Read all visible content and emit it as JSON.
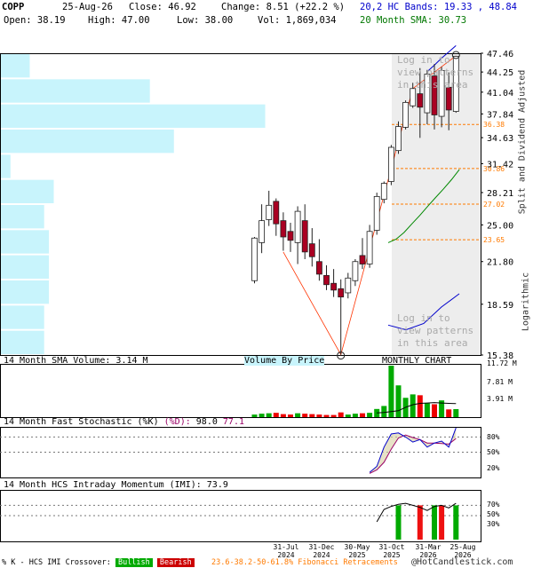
{
  "header": {
    "symbol": "COPP",
    "date": "25-Aug-26",
    "close_label": "Close: 46.92",
    "change_label": "Change: 8.51 (+22.2 %)",
    "open_label": "Open: 38.19",
    "high_label": "High: 47.00",
    "low_label": "Low: 38.00",
    "vol_label": "Vol: 1,869,034",
    "hc_bands_label": "20,2 HC Bands: 19.33 , 48.84",
    "sma_label": "20 Month SMA: 30.73"
  },
  "watermark": "Log in to view patterns in this area",
  "side_labels": {
    "split": "Split and Dividend Adjusted",
    "log": "Logarithmic"
  },
  "panel_titles": {
    "volume_sma": "14 Month SMA Volume: 3.14 M",
    "volume_by_price": "Volume By Price",
    "monthly": "MONTHLY CHART",
    "stoch_prefix": "14 Month Fast Stochastic (%K)",
    "stoch_d": "(%D):",
    "stoch_k_val": "98.0",
    "stoch_d_val": "77.1",
    "imi": "14 Month HCS Intraday Momentum (IMI): 73.9"
  },
  "footer": {
    "crossover": "% K - HCS IMI Crossover:",
    "bullish": "Bullish",
    "bearish": "Bearish",
    "fib": "23.6-38.2-50-61.8% Fibonacci Retracements",
    "copyright": "@HotCandlestick.com"
  },
  "colors": {
    "bull": "#00aa00",
    "bear": "#aa0022",
    "vbp": "#c8f4fc",
    "band": "#0000cc",
    "sma": "#008800",
    "fib": "#ff7a00",
    "trend": "#ff3300",
    "shade": "#ededed"
  },
  "chart_data": [
    {
      "type": "candlestick",
      "title": "MONTHLY CHART",
      "x_tick_labels": [
        "31-Jul 2024",
        "31-Dec 2024",
        "30-May 2025",
        "31-Oct 2025",
        "31-Mar 2026",
        "25-Aug 2026"
      ],
      "y_ticks": [
        47.46,
        44.25,
        41.04,
        37.84,
        34.63,
        31.42,
        28.21,
        25.0,
        21.8,
        18.59,
        15.38
      ],
      "y_scale": "log",
      "ylim": [
        15.38,
        47.46
      ],
      "fib_levels": [
        36.38,
        30.86,
        27.02,
        23.65
      ],
      "candles": [
        {
          "o": 20.3,
          "h": 23.9,
          "l": 20.1,
          "c": 23.8
        },
        {
          "o": 23.4,
          "h": 27.0,
          "l": 22.5,
          "c": 25.4
        },
        {
          "o": 25.5,
          "h": 28.4,
          "l": 24.9,
          "c": 26.9
        },
        {
          "o": 27.3,
          "h": 27.6,
          "l": 24.0,
          "c": 25.1
        },
        {
          "o": 25.4,
          "h": 26.2,
          "l": 22.7,
          "c": 23.9
        },
        {
          "o": 24.4,
          "h": 25.2,
          "l": 22.6,
          "c": 23.6
        },
        {
          "o": 23.4,
          "h": 26.8,
          "l": 21.6,
          "c": 26.3
        },
        {
          "o": 25.4,
          "h": 27.0,
          "l": 22.0,
          "c": 22.6
        },
        {
          "o": 23.3,
          "h": 24.7,
          "l": 21.4,
          "c": 22.2
        },
        {
          "o": 21.8,
          "h": 23.7,
          "l": 20.3,
          "c": 20.8
        },
        {
          "o": 20.7,
          "h": 21.5,
          "l": 19.6,
          "c": 20.0
        },
        {
          "o": 20.1,
          "h": 21.2,
          "l": 19.1,
          "c": 19.6
        },
        {
          "o": 19.7,
          "h": 20.4,
          "l": 15.4,
          "c": 19.1
        },
        {
          "o": 19.4,
          "h": 20.9,
          "l": 19.0,
          "c": 20.5
        },
        {
          "o": 20.3,
          "h": 22.0,
          "l": 19.9,
          "c": 21.8
        },
        {
          "o": 22.3,
          "h": 23.8,
          "l": 21.2,
          "c": 21.6
        },
        {
          "o": 21.6,
          "h": 25.0,
          "l": 21.3,
          "c": 24.4
        },
        {
          "o": 24.5,
          "h": 28.2,
          "l": 24.1,
          "c": 27.8
        },
        {
          "o": 27.5,
          "h": 29.4,
          "l": 27.1,
          "c": 29.2
        },
        {
          "o": 29.4,
          "h": 33.7,
          "l": 29.0,
          "c": 33.4
        },
        {
          "o": 33.0,
          "h": 36.8,
          "l": 32.6,
          "c": 36.1
        },
        {
          "o": 36.0,
          "h": 39.8,
          "l": 35.7,
          "c": 39.5
        },
        {
          "o": 39.0,
          "h": 42.5,
          "l": 38.7,
          "c": 41.6
        },
        {
          "o": 40.8,
          "h": 44.9,
          "l": 34.6,
          "c": 38.8
        },
        {
          "o": 38.0,
          "h": 44.6,
          "l": 36.4,
          "c": 43.9
        },
        {
          "o": 43.6,
          "h": 45.6,
          "l": 35.7,
          "c": 37.7
        },
        {
          "o": 37.5,
          "h": 45.1,
          "l": 36.0,
          "c": 44.5
        },
        {
          "o": 41.8,
          "h": 44.2,
          "l": 35.6,
          "c": 38.4
        },
        {
          "o": 38.19,
          "h": 47.0,
          "l": 38.0,
          "c": 46.92
        }
      ],
      "upper_band": [
        44.3,
        45.4,
        46.6,
        47.7,
        48.84
      ],
      "lower_band": [
        17.2,
        16.9,
        17.3,
        18.4,
        19.33
      ],
      "sma": [
        23.4,
        23.7,
        24.3,
        25.1,
        25.9,
        26.8,
        27.7,
        28.6,
        29.6,
        30.73
      ],
      "vbp_widths": [
        0.06,
        0.31,
        0.55,
        0.36,
        0.02,
        0.11,
        0.09,
        0.1,
        0.1,
        0.1,
        0.09,
        0.09
      ],
      "annotations": [
        "Log in to view patterns in this area"
      ]
    },
    {
      "type": "bar",
      "title": "14 Month SMA Volume: 3.14 M",
      "y_ticks": [
        "11.72 M",
        "7.81 M",
        "3.91 M"
      ],
      "ylim": [
        0,
        12.0
      ],
      "values": [
        0.6,
        0.8,
        0.9,
        1.0,
        0.7,
        0.6,
        0.9,
        0.8,
        0.7,
        0.6,
        0.5,
        0.5,
        1.1,
        0.6,
        0.8,
        0.9,
        1.0,
        1.9,
        2.6,
        12.0,
        7.4,
        4.5,
        5.3,
        5.1,
        3.2,
        3.0,
        3.9,
        1.8,
        1.87
      ],
      "sma_line": [
        1.0,
        1.1,
        1.3,
        1.5,
        2.3,
        2.9,
        3.2,
        3.3,
        3.4,
        3.3,
        3.2,
        3.14
      ]
    },
    {
      "type": "line",
      "title": "14 Month Fast Stochastic (%K) (%D): 98.0 77.1",
      "y_ticks": [
        "80%",
        "50%",
        "20%"
      ],
      "ylim": [
        0,
        100
      ],
      "k": [
        10,
        22,
        60,
        86,
        88,
        80,
        70,
        75,
        60,
        68,
        72,
        60,
        98.0
      ],
      "d": [
        8,
        15,
        30,
        56,
        78,
        84,
        79,
        75,
        68,
        68,
        67,
        66,
        77.1
      ]
    },
    {
      "type": "bar",
      "title": "14 Month HCS Intraday Momentum (IMI): 73.9",
      "y_ticks": [
        "70%",
        "50%",
        "30%"
      ],
      "ylim": [
        0,
        100
      ],
      "imi_line": [
        38,
        62,
        68,
        72,
        74,
        70,
        66,
        60,
        68,
        70,
        65,
        73.9
      ],
      "crossover_signals": [
        {
          "month_index": 20,
          "signal": "bullish"
        },
        {
          "month_index": 23,
          "signal": "bearish"
        },
        {
          "month_index": 25,
          "signal": "bullish"
        },
        {
          "month_index": 26,
          "signal": "bearish"
        },
        {
          "month_index": 28,
          "signal": "bullish"
        }
      ]
    }
  ]
}
